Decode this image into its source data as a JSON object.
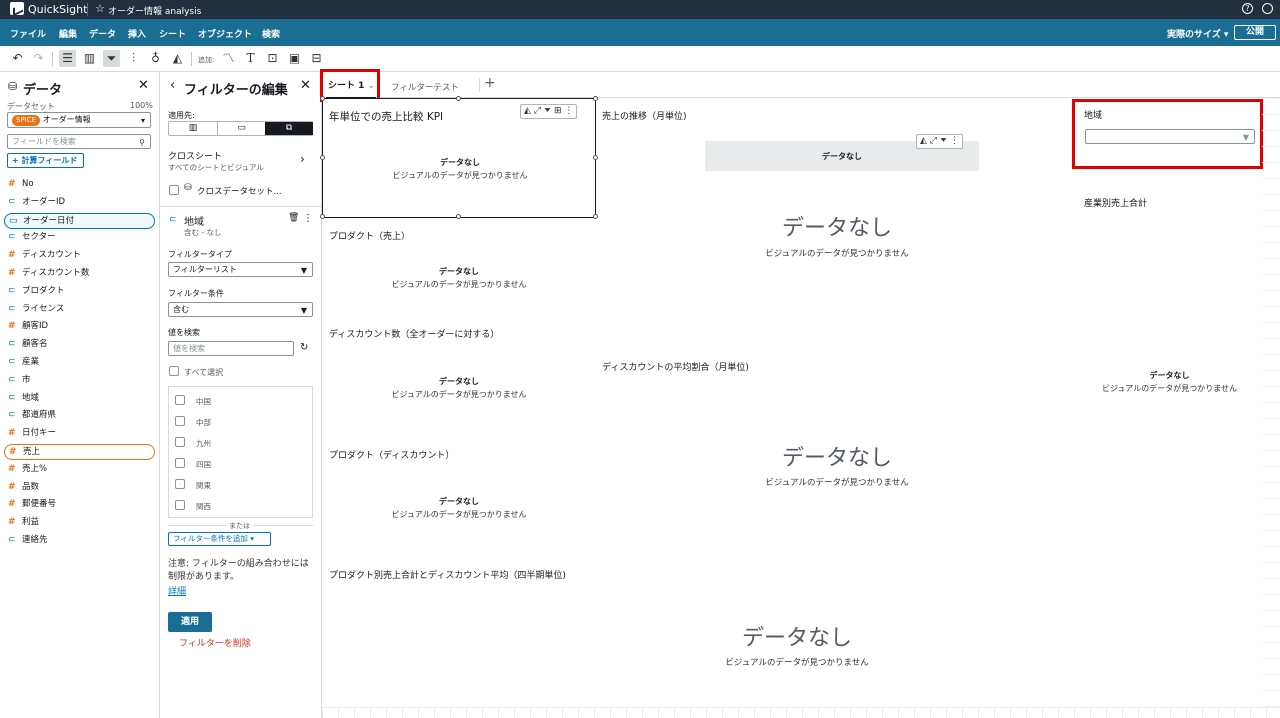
{
  "topbar": {
    "brand": "QuickSight",
    "analysis_name": "オーダー情報 analysis"
  },
  "menu": {
    "items": [
      "ファイル",
      "編集",
      "データ",
      "挿入",
      "シート",
      "オブジェクト",
      "検索"
    ],
    "size_label": "実際のサイズ",
    "publish": "公開"
  },
  "toolbar": {
    "add_label": "追加:"
  },
  "data_panel": {
    "title": "データ",
    "dataset_label": "データセット",
    "dataset_pct": "100%",
    "spice_badge": "SPICE",
    "dataset_name": "オーダー情報",
    "search_placeholder": "フィールドを検索",
    "calc_field": "計算フィールド",
    "fields": [
      {
        "name": "No",
        "type": "num"
      },
      {
        "name": "オーダーID",
        "type": "dim"
      },
      {
        "name": "オーダー日付",
        "type": "date"
      },
      {
        "name": "セクター",
        "type": "dim"
      },
      {
        "name": "ディスカウント",
        "type": "num"
      },
      {
        "name": "ディスカウント数",
        "type": "num"
      },
      {
        "name": "プロダクト",
        "type": "dim"
      },
      {
        "name": "ライセンス",
        "type": "dim"
      },
      {
        "name": "顧客ID",
        "type": "num"
      },
      {
        "name": "顧客名",
        "type": "dim"
      },
      {
        "name": "産業",
        "type": "dim"
      },
      {
        "name": "市",
        "type": "dim"
      },
      {
        "name": "地域",
        "type": "dim"
      },
      {
        "name": "都道府県",
        "type": "dim"
      },
      {
        "name": "日付キー",
        "type": "num"
      },
      {
        "name": "売上",
        "type": "num"
      },
      {
        "name": "売上%",
        "type": "num"
      },
      {
        "name": "品数",
        "type": "num"
      },
      {
        "name": "郵便番号",
        "type": "num"
      },
      {
        "name": "利益",
        "type": "num"
      },
      {
        "name": "連絡先",
        "type": "dim"
      }
    ]
  },
  "filter_panel": {
    "title": "フィルターの編集",
    "apply_to": "適用先:",
    "cross_sheet": "クロスシート",
    "cross_sheet_sub": "すべてのシートとビジュアル",
    "cross_dataset": "クロスデータセット...",
    "filter_field": "地域",
    "filter_field_sub": "含む - なし",
    "filter_type_label": "フィルタータイプ",
    "filter_type_value": "フィルターリスト",
    "condition_label": "フィルター条件",
    "condition_value": "含む",
    "search_values_label": "値を検索",
    "search_values_placeholder": "値を検索",
    "select_all": "すべて選択",
    "values": [
      "中国",
      "中部",
      "九州",
      "四国",
      "関東",
      "関西"
    ],
    "or_label": "または",
    "add_condition": "フィルター条件を追加",
    "note": "注意: フィルターの組み合わせには制限があります。",
    "details": "詳細",
    "apply": "適用",
    "delete": "フィルターを削除"
  },
  "tabs": {
    "sheet1": "シート 1",
    "sheet2": "フィルターテスト"
  },
  "visuals": {
    "no_data": "データなし",
    "no_data_sub": "ビジュアルのデータが見つかりません",
    "kpi_title": "年単位での売上比較 KPI",
    "trend_title": "売上の推移（月単位)",
    "region_title": "地域",
    "industry_title": "産業別売上合計",
    "product_sales_title": "プロダクト（売上）",
    "discount_count_title": "ディスカウント数（全オーダーに対する）",
    "discount_avg_title": "ディスカウントの平均割合（月単位)",
    "product_discount_title": "プロダクト（ディスカウント）",
    "product_quarter_title": "プロダクト別売上合計とディスカウント平均（四半期単位)"
  }
}
